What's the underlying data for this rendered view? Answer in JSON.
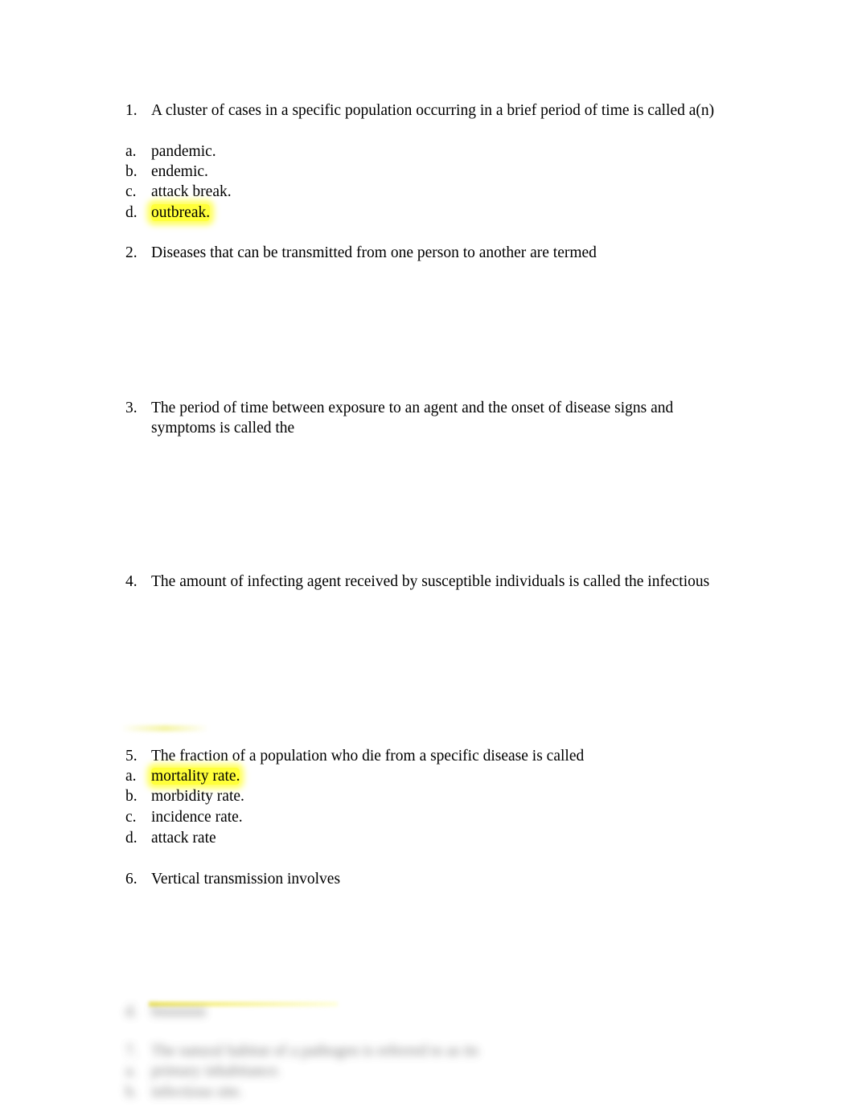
{
  "questions": [
    {
      "number": "1.",
      "text": "A cluster of cases in a specific population occurring in a brief period of time is called a(n)",
      "options": [
        {
          "letter": "a.",
          "text": "pandemic.",
          "highlighted": false
        },
        {
          "letter": "b.",
          "text": "endemic.",
          "highlighted": false
        },
        {
          "letter": "c.",
          "text": "attack break.",
          "highlighted": false
        },
        {
          "letter": "d.",
          "text": "outbreak.",
          "highlighted": true
        }
      ]
    },
    {
      "number": "2.",
      "text": "Diseases that can be transmitted from one person to another are termed",
      "options": []
    },
    {
      "number": "3.",
      "text_line1": "The period of time between exposure to an agent and the onset of disease signs and",
      "text_line2": "symptoms is called the",
      "options": []
    },
    {
      "number": "4.",
      "text": "The amount of infecting agent received by susceptible individuals is called the infectious",
      "options": []
    },
    {
      "number": "5.",
      "text": "The fraction of a population who die from a specific disease is called",
      "options": [
        {
          "letter": "a.",
          "text": "mortality rate.",
          "highlighted": true
        },
        {
          "letter": "b.",
          "text": "morbidity rate.",
          "highlighted": false
        },
        {
          "letter": "c.",
          "text": "incidence rate.",
          "highlighted": false
        },
        {
          "letter": "d.",
          "text": "attack rate",
          "highlighted": false
        }
      ]
    },
    {
      "number": "6.",
      "text": "Vertical transmission involves",
      "options": []
    }
  ],
  "blurred": {
    "line1_num": "d.",
    "line1_text": "bnnnnnn",
    "line2_num": "7.",
    "line2_text": "The natural habitat of a pathogen is referred to as its",
    "line3_num": "a.",
    "line3_text": "primary inhabitance.",
    "line4_num": "b.",
    "line4_text": "infectious site."
  },
  "colors": {
    "highlight": "#ffff3a"
  }
}
